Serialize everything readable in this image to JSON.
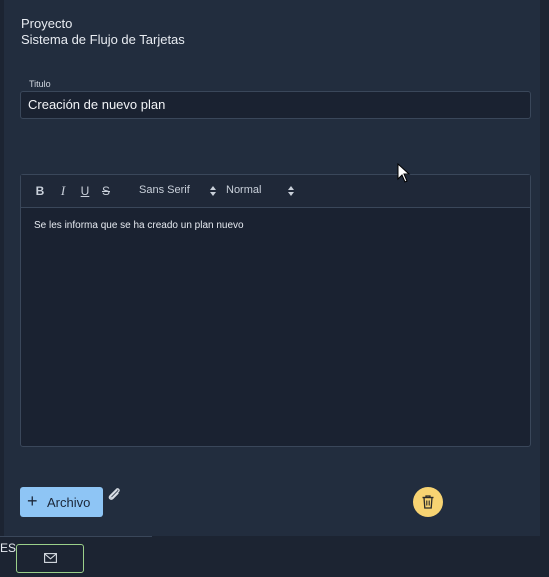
{
  "project": {
    "label": "Proyecto",
    "name": "Sistema de Flujo de Tarjetas"
  },
  "title_field": {
    "label": "Titulo",
    "value": "Creación de nuevo plan"
  },
  "editor": {
    "toolbar": {
      "bold": "B",
      "italic": "I",
      "underline": "U",
      "strike": "S",
      "font": "Sans Serif",
      "size": "Normal"
    },
    "content": "Se les informa que se ha creado un plan nuevo"
  },
  "actions": {
    "archivo_label": "Archivo",
    "attach_icon": "paperclip-icon",
    "delete_icon": "trash-icon"
  },
  "footer": {
    "language": "ES",
    "mail_icon": "envelope-icon"
  },
  "colors": {
    "background": "#1c2432",
    "panel": "#222d3e",
    "primary_button": "#8ec5f5",
    "delete_button": "#f7d372",
    "mail_border": "#9bd08a"
  }
}
